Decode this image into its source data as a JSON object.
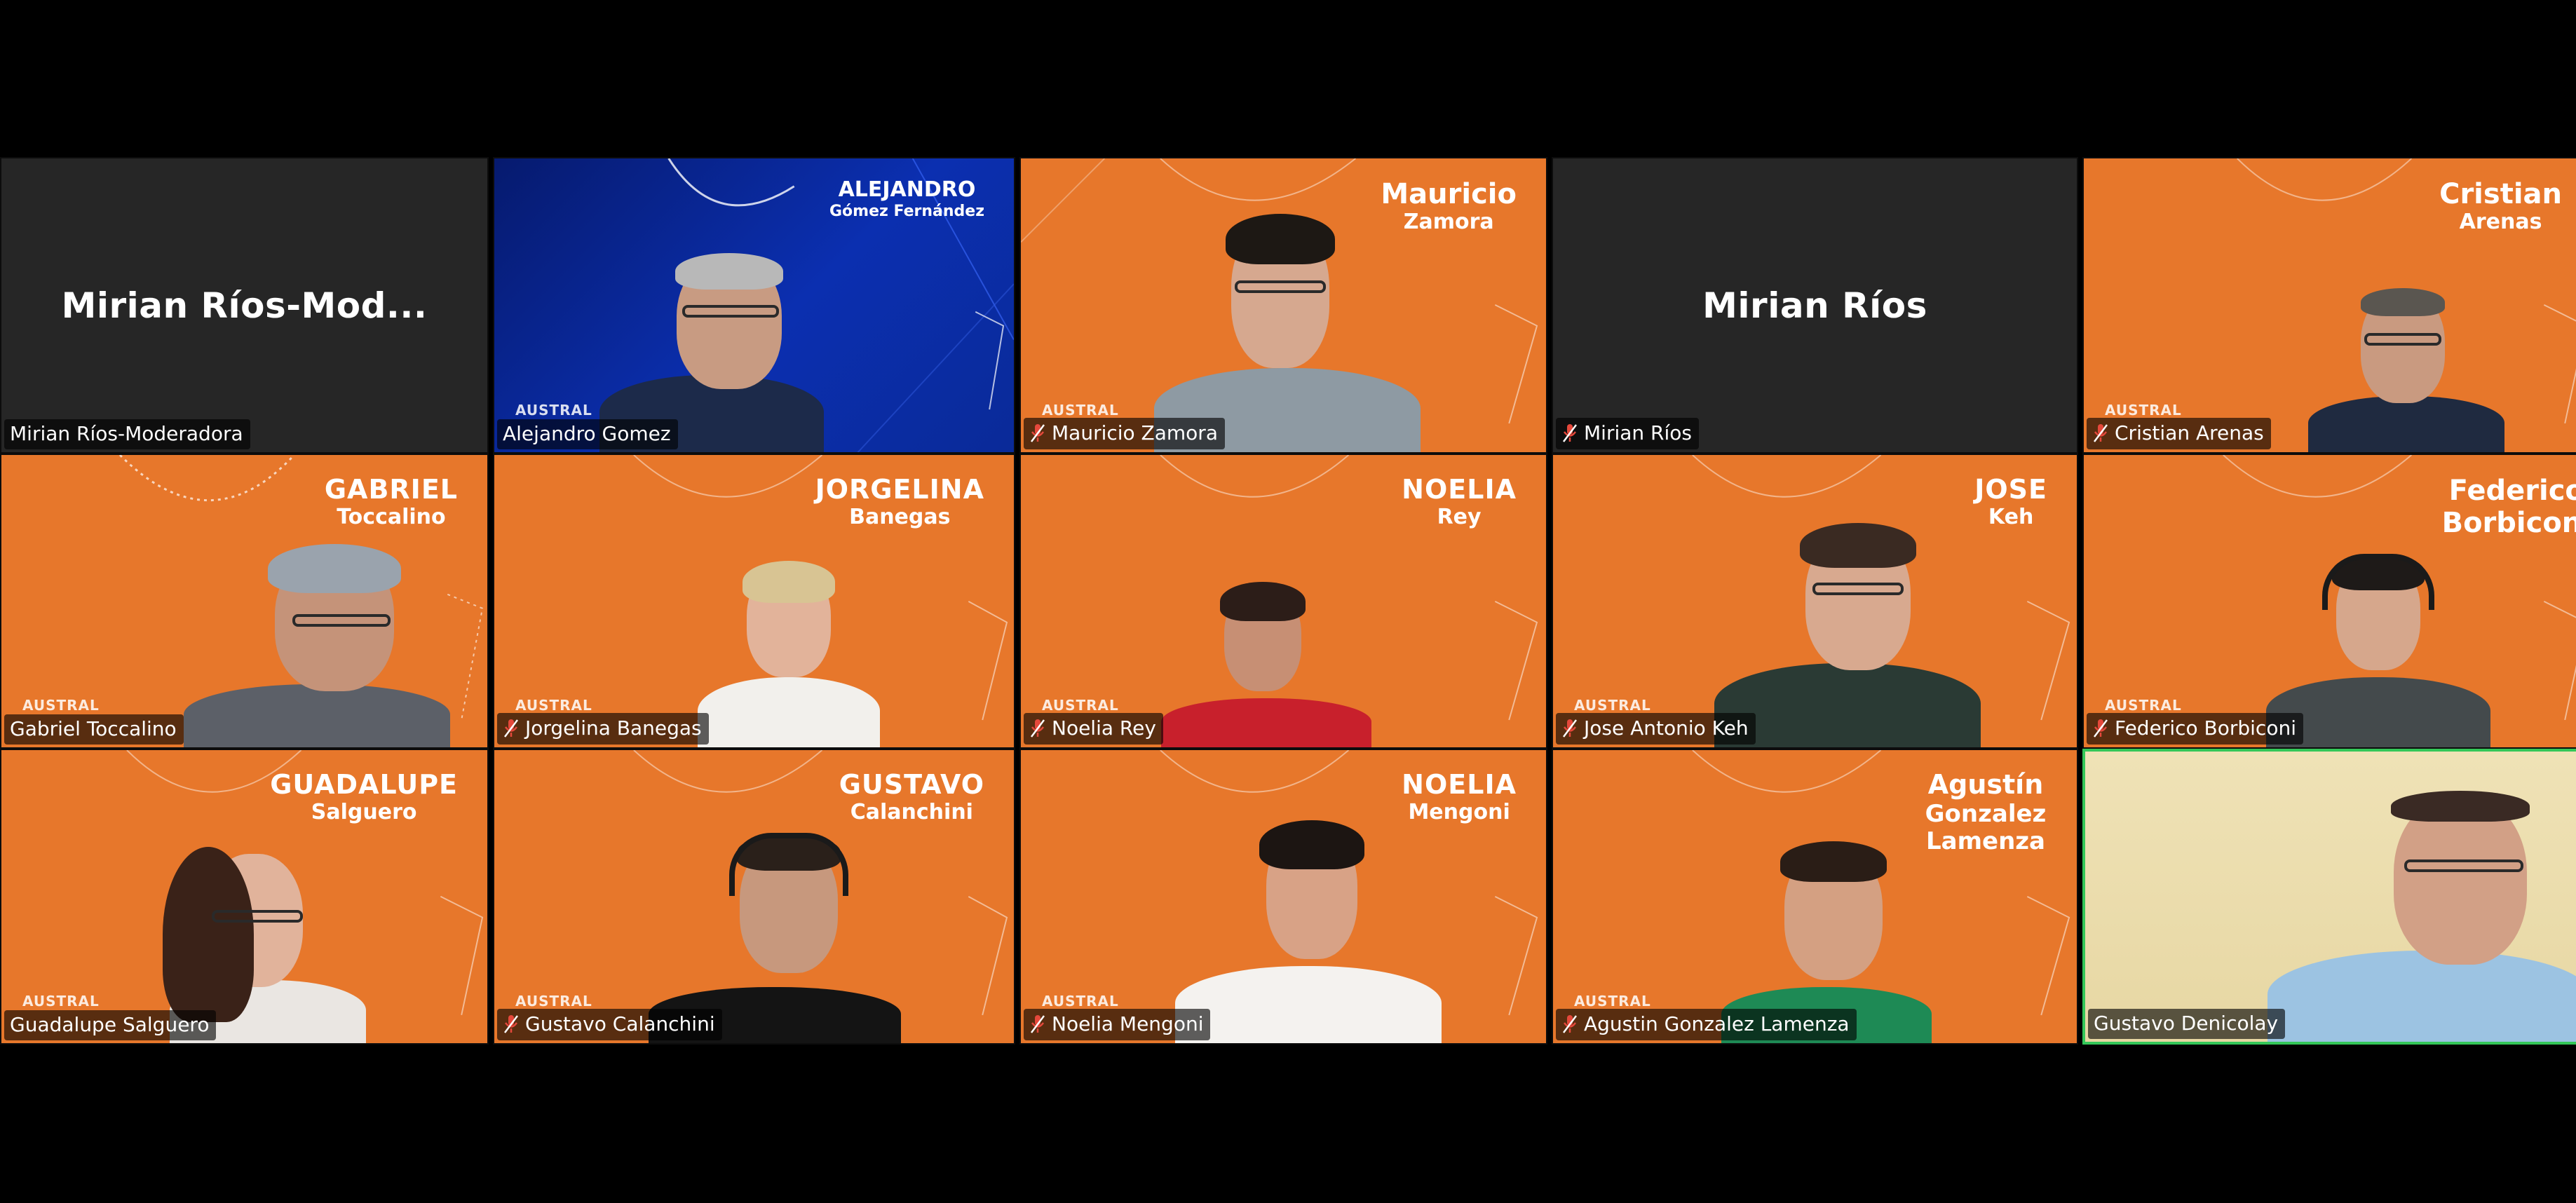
{
  "colors": {
    "background": "#000000",
    "tile_dark": "#262626",
    "tile_orange": "#e7772b",
    "active_speaker_border": "#34c759",
    "muted_icon": "#e5483b"
  },
  "tiles": [
    {
      "id": "mirian-rios-moderadora",
      "kind": "name-only",
      "display_name": "Mirian Ríos-Mod...",
      "label": "Mirian Ríos-Moderadora",
      "muted": false
    },
    {
      "id": "alejandro-gomez",
      "kind": "video",
      "bg": "blue",
      "title_line1": "ALEJANDRO",
      "title_line2": "Gómez Fernández",
      "brand": "AUSTRAL",
      "label": "Alejandro Gomez",
      "muted": false
    },
    {
      "id": "mauricio-zamora",
      "kind": "video",
      "bg": "orange",
      "title_line1": "Mauricio",
      "title_line2": "Zamora",
      "brand": "AUSTRAL",
      "label": "Mauricio Zamora",
      "muted": true
    },
    {
      "id": "mirian-rios",
      "kind": "name-only",
      "display_name": "Mirian Ríos",
      "label": "Mirian Ríos",
      "muted": true
    },
    {
      "id": "cristian-arenas",
      "kind": "video",
      "bg": "orange",
      "title_line1": "Cristian",
      "title_line2": "Arenas",
      "brand": "AUSTRAL",
      "label": "Cristian Arenas",
      "muted": true
    },
    {
      "id": "gabriel-toccalino",
      "kind": "video",
      "bg": "orange",
      "title_line1": "GABRIEL",
      "title_line2": "Toccalino",
      "brand": "AUSTRAL",
      "label": "Gabriel Toccalino",
      "muted": false
    },
    {
      "id": "jorgelina-banegas",
      "kind": "video",
      "bg": "orange",
      "title_line1": "JORGELINA",
      "title_line2": "Banegas",
      "brand": "AUSTRAL",
      "label": "Jorgelina Banegas",
      "muted": true
    },
    {
      "id": "noelia-rey",
      "kind": "video",
      "bg": "orange",
      "title_line1": "NOELIA",
      "title_line2": "Rey",
      "brand": "AUSTRAL",
      "label": "Noelia Rey",
      "muted": true
    },
    {
      "id": "jose-antonio-keh",
      "kind": "video",
      "bg": "orange",
      "title_line1": "JOSE",
      "title_line2": "Keh",
      "brand": "AUSTRAL",
      "label": "Jose Antonio Keh",
      "muted": true
    },
    {
      "id": "federico-borbiconi",
      "kind": "video",
      "bg": "orange",
      "title_line1": "Federico",
      "title_line2": "Borbiconi",
      "brand": "AUSTRAL",
      "label": "Federico Borbiconi",
      "muted": true
    },
    {
      "id": "guadalupe-salguero",
      "kind": "video",
      "bg": "orange",
      "title_line1": "GUADALUPE",
      "title_line2": "Salguero",
      "brand": "AUSTRAL",
      "label": "Guadalupe Salguero",
      "muted": false
    },
    {
      "id": "gustavo-calanchini",
      "kind": "video",
      "bg": "orange",
      "title_line1": "GUSTAVO",
      "title_line2": "Calanchini",
      "brand": "AUSTRAL",
      "label": "Gustavo Calanchini",
      "muted": true
    },
    {
      "id": "noelia-mengoni",
      "kind": "video",
      "bg": "orange",
      "title_line1": "NOELIA",
      "title_line2": "Mengoni",
      "brand": "AUSTRAL",
      "label": "Noelia Mengoni",
      "muted": true
    },
    {
      "id": "agustin-gonzalez-lamenza",
      "kind": "video",
      "bg": "orange",
      "title_line1": "Agustín",
      "title_line2": "Gonzalez Lamenza",
      "brand": "AUSTRAL",
      "label": "Agustin Gonzalez Lamenza",
      "muted": true
    },
    {
      "id": "gustavo-denicolay",
      "kind": "video",
      "bg": "beige",
      "title_line1": "",
      "title_line2": "",
      "brand": "",
      "label": "Gustavo Denicolay",
      "muted": false,
      "active_speaker": true
    }
  ]
}
